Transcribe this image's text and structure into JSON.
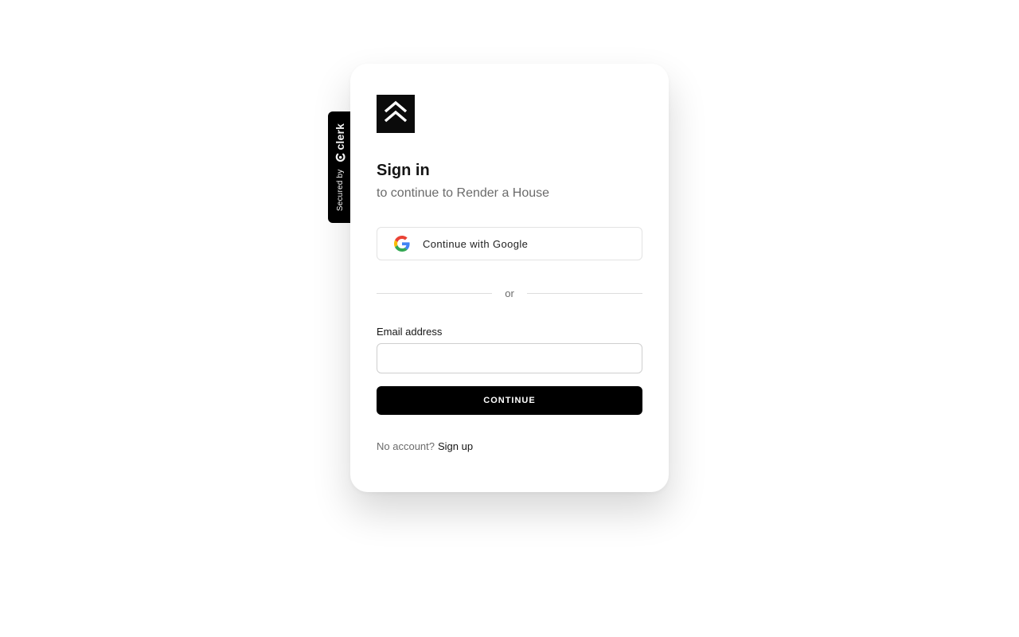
{
  "clerk_badge": {
    "secured_by": "Secured by",
    "brand": "clerk",
    "icon": "clerk-logo-icon"
  },
  "logo": {
    "icon": "double-chevron-up-icon",
    "background": "#0b0b0b"
  },
  "header": {
    "title": "Sign in",
    "subtitle": "to continue to Render a House"
  },
  "social": {
    "google_label": "Continue with Google",
    "google_icon": "google-g-icon"
  },
  "divider": {
    "text": "or"
  },
  "form": {
    "email_label": "Email address",
    "email_value": "",
    "email_placeholder": "",
    "continue_label": "CONTINUE"
  },
  "footer": {
    "no_account_text": "No account?",
    "signup_link": "Sign up"
  },
  "colors": {
    "primary_button": "#000000",
    "muted_text": "#6b6b6b",
    "border": "#e3e3e3"
  }
}
